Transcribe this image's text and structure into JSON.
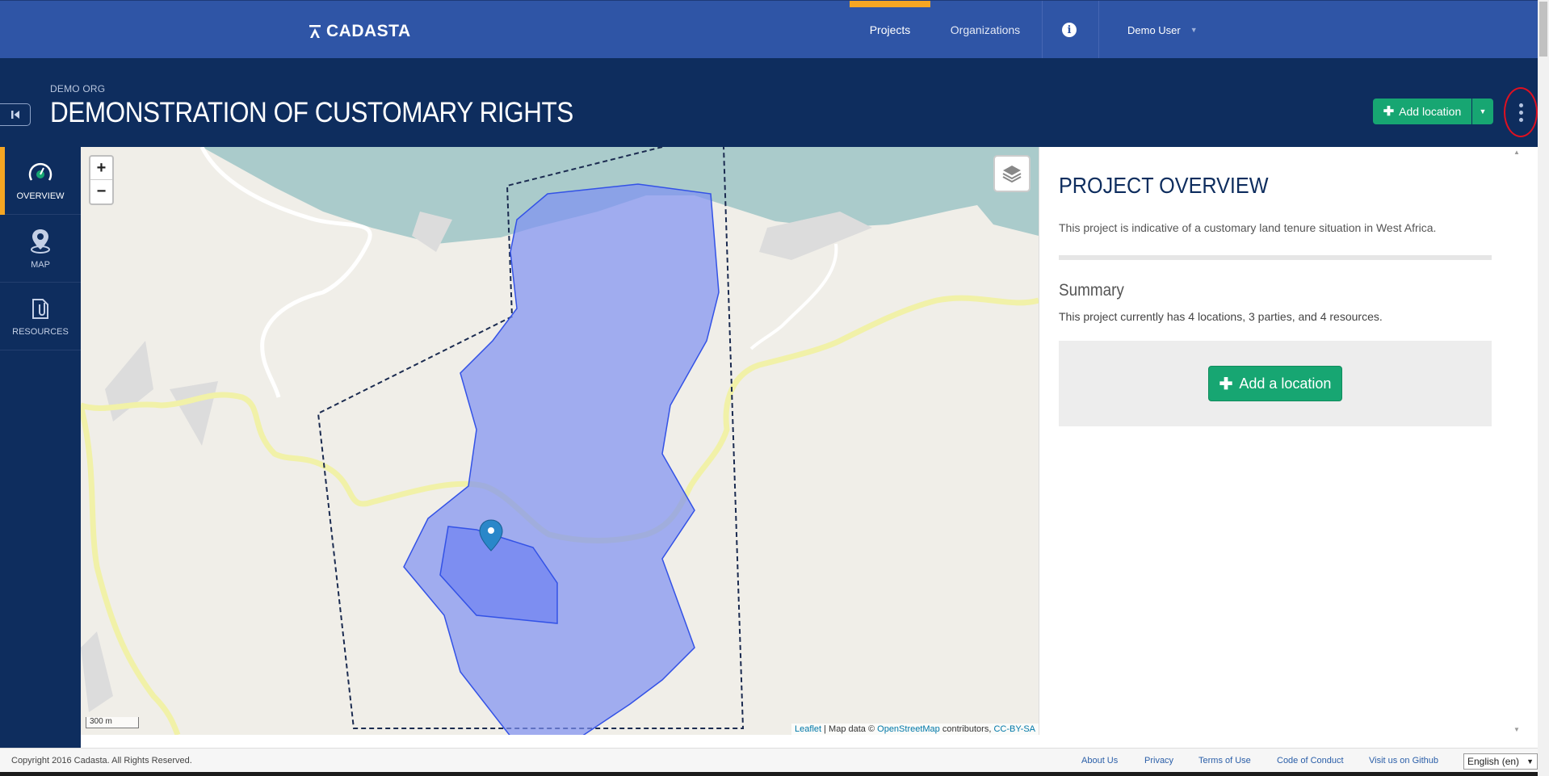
{
  "topnav": {
    "logo_text": "CADASTA",
    "projects_label": "Projects",
    "organizations_label": "Organizations",
    "user_label": "Demo User",
    "accent_color": "#f5a623"
  },
  "header": {
    "org_name": "DEMO ORG",
    "project_title": "DEMONSTRATION OF CUSTOMARY RIGHTS",
    "add_location_label": "Add location"
  },
  "sidebar": {
    "items": [
      {
        "label": "OVERVIEW",
        "icon": "dashboard-icon",
        "active": true
      },
      {
        "label": "MAP",
        "icon": "map-pin-icon",
        "active": false
      },
      {
        "label": "RESOURCES",
        "icon": "attachment-icon",
        "active": false
      }
    ]
  },
  "map": {
    "zoom_in": "+",
    "zoom_out": "−",
    "scale_label": "300 m",
    "attribution": {
      "leaflet": "Leaflet",
      "map_data": " | Map data © ",
      "osm": "OpenStreetMap",
      "contributors": " contributors, ",
      "license": "CC-BY-SA"
    }
  },
  "panel": {
    "title": "PROJECT OVERVIEW",
    "description": "This project is indicative of a customary land tenure situation in West Africa.",
    "summary_title": "Summary",
    "summary_text": "This project currently has 4 locations, 3 parties, and 4 resources.",
    "add_location_label": "Add a location"
  },
  "footer": {
    "copyright": "Copyright 2016 Cadasta. All Rights Reserved.",
    "links": [
      "About Us",
      "Privacy",
      "Terms of Use",
      "Code of Conduct",
      "Visit us on Github"
    ],
    "language": "English (en)"
  }
}
